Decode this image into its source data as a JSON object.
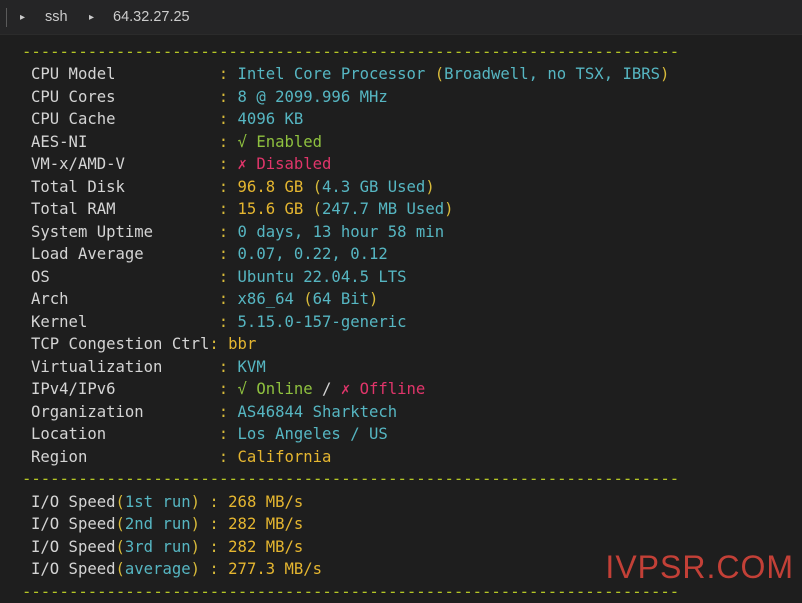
{
  "tabbar": {
    "crumbs": [
      "ssh",
      "64.32.27.25"
    ]
  },
  "divider": "----------------------------------------------------------------------",
  "sysinfo": [
    {
      "label": "CPU Model           ",
      "value": "Intel Core Processor ",
      "paren_open": "(",
      "extra": "Broadwell, no TSX, IBRS",
      "paren_close": ")",
      "value_color": "cyan",
      "extra_color": "cyan"
    },
    {
      "label": "CPU Cores           ",
      "value": "8 @ 2099.996 MHz",
      "value_color": "cyan"
    },
    {
      "label": "CPU Cache           ",
      "value": "4096 KB",
      "value_color": "cyan"
    },
    {
      "label": "AES-NI              ",
      "value": "√ Enabled",
      "value_color": "green"
    },
    {
      "label": "VM-x/AMD-V          ",
      "value": "✗ Disabled",
      "value_color": "red"
    },
    {
      "label": "Total Disk          ",
      "value": "96.8 GB ",
      "paren_open": "(",
      "extra": "4.3 GB Used",
      "paren_close": ")",
      "value_color": "yellow",
      "extra_color": "cyan"
    },
    {
      "label": "Total RAM           ",
      "value": "15.6 GB ",
      "paren_open": "(",
      "extra": "247.7 MB Used",
      "paren_close": ")",
      "value_color": "yellow",
      "extra_color": "cyan"
    },
    {
      "label": "System Uptime       ",
      "value": "0 days, 13 hour 58 min",
      "value_color": "cyan"
    },
    {
      "label": "Load Average        ",
      "value": "0.07, 0.22, 0.12",
      "value_color": "cyan"
    },
    {
      "label": "OS                  ",
      "value": "Ubuntu 22.04.5 LTS",
      "value_color": "cyan"
    },
    {
      "label": "Arch                ",
      "value": "x86_64 ",
      "paren_open": "(",
      "extra": "64 Bit",
      "paren_close": ")",
      "value_color": "cyan",
      "extra_color": "cyan"
    },
    {
      "label": "Kernel              ",
      "value": "5.15.0-157-generic",
      "value_color": "cyan"
    },
    {
      "label": "TCP Congestion Ctrl",
      "value": "bbr",
      "value_color": "yellow"
    },
    {
      "label": "Virtualization      ",
      "value": "KVM",
      "value_color": "cyan"
    },
    {
      "label": "IPv4/IPv6           ",
      "value": "√ Online",
      "sep": " / ",
      "value2": "✗ Offline",
      "value_color": "green",
      "value2_color": "red"
    },
    {
      "label": "Organization        ",
      "value": "AS46844 Sharktech",
      "value_color": "cyan"
    },
    {
      "label": "Location            ",
      "value": "Los Angeles / US",
      "value_color": "cyan"
    },
    {
      "label": "Region              ",
      "value": "California",
      "value_color": "yellow"
    }
  ],
  "io": [
    {
      "pre": "I/O Speed",
      "paren_open": "(",
      "run": "1st run",
      "paren_close": ")",
      "pad": " ",
      "value": "268 MB/s"
    },
    {
      "pre": "I/O Speed",
      "paren_open": "(",
      "run": "2nd run",
      "paren_close": ")",
      "pad": " ",
      "value": "282 MB/s"
    },
    {
      "pre": "I/O Speed",
      "paren_open": "(",
      "run": "3rd run",
      "paren_close": ")",
      "pad": " ",
      "value": "282 MB/s"
    },
    {
      "pre": "I/O Speed",
      "paren_open": "(",
      "run": "average",
      "paren_close": ")",
      "pad": " ",
      "value": "277.3 MB/s"
    }
  ],
  "colon": ": ",
  "watermark": "IVPSR.COM"
}
